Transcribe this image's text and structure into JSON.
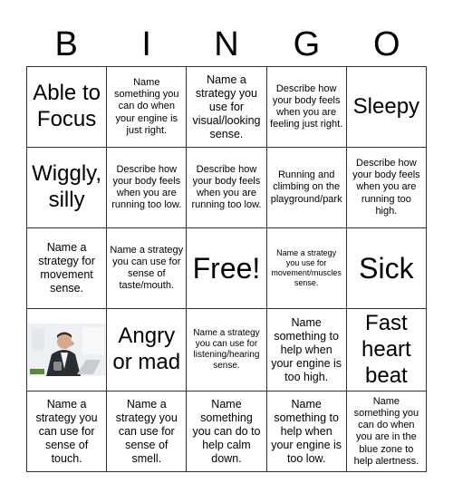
{
  "header": {
    "letters": [
      "B",
      "I",
      "N",
      "G",
      "O"
    ]
  },
  "cells": [
    [
      "Able to Focus",
      "Name something you can do when your engine is just right.",
      "Name a strategy you use for visual/looking sense.",
      "Describe how your body feels when you are feeling just right.",
      "Sleepy"
    ],
    [
      "Wiggly, silly",
      "Describe how your body feels when you are running too low.",
      "Describe how your body feels when you are running too low.",
      "Running and climbing on the playground/park",
      "Describe how your body feels when you are running too high."
    ],
    [
      "Name a strategy for movement sense.",
      "Name a strategy you can use for sense of taste/mouth.",
      "Free!",
      "Name a strategy you use for movement/muscles sense.",
      "Sick"
    ],
    [
      "[image: yawning man at desk]",
      "Angry or mad",
      "Name a strategy you can use for listening/hearing sense.",
      "Name something to help when your engine is too high.",
      "Fast heart beat"
    ],
    [
      "Name a strategy you can use for sense of touch.",
      "Name a strategy you can use for sense of smell.",
      "Name something you can do to help calm down.",
      "Name something to help when your engine is too low.",
      "Name something you can do when you are in the blue zone to help alertness."
    ]
  ],
  "image_cell": {
    "alt": "Yawning man in suit at desk with laptop and mug"
  }
}
